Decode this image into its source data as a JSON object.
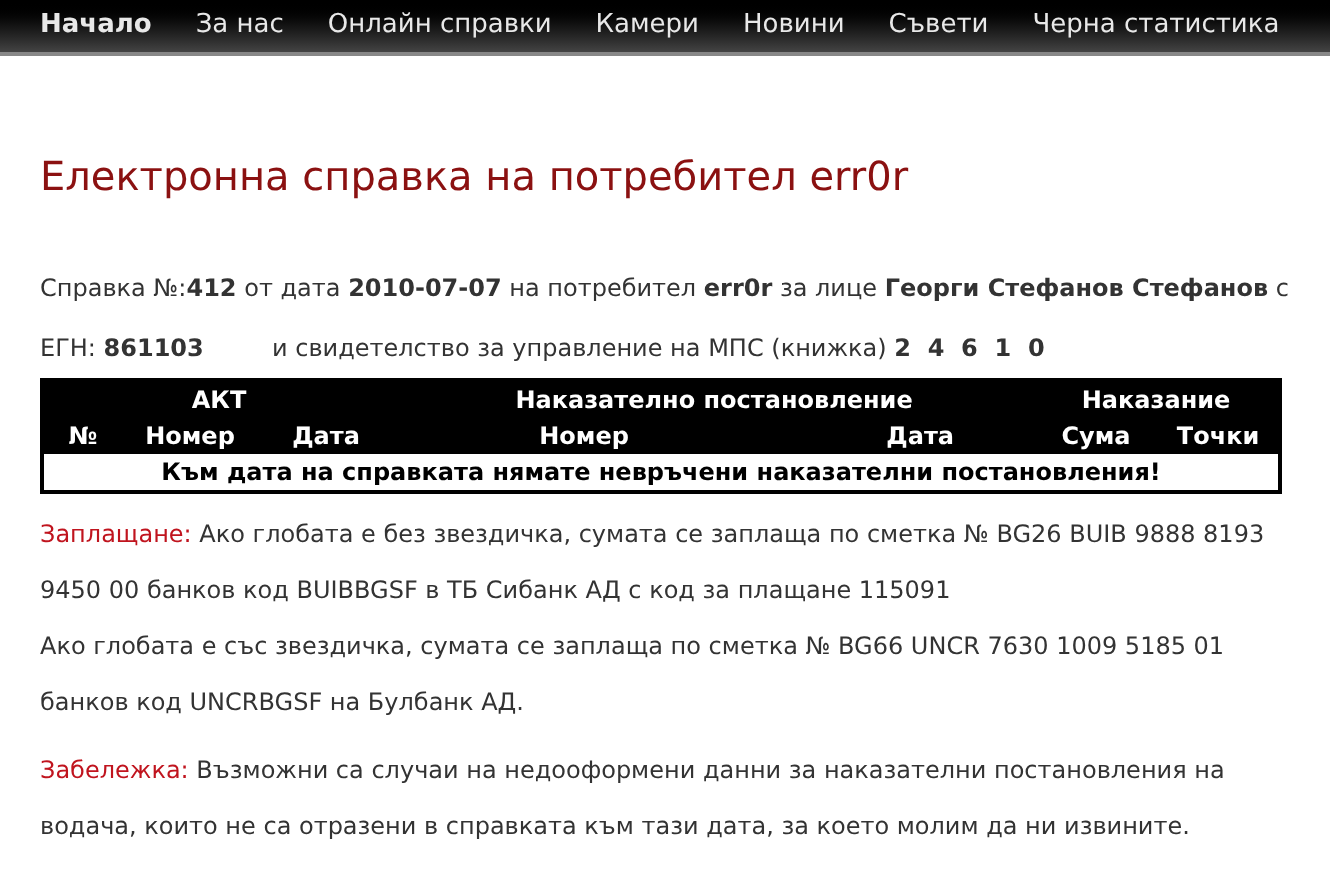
{
  "nav": [
    {
      "label": "Начало",
      "selected": true
    },
    {
      "label": "За нас",
      "selected": false
    },
    {
      "label": "Онлайн справки",
      "selected": false
    },
    {
      "label": "Камери",
      "selected": false
    },
    {
      "label": "Новини",
      "selected": false
    },
    {
      "label": "Съвети",
      "selected": false
    },
    {
      "label": "Черна статистика",
      "selected": false
    }
  ],
  "title": "Електронна справка на потребител err0r",
  "report": {
    "line_1": "Справка №:**412** от дата **2010-07-07** на потребител **err0r** за лице **Георги Стефанов Стефанов** с",
    "egn": "ЕГН: **861103**",
    "license": "и свидетелство за управление на МПС (книжка) **2  4  6  1  0**"
  },
  "table": {
    "groups": [
      "АКТ",
      "Наказателно постановление",
      "Наказание"
    ],
    "columns": [
      "№",
      "Номер",
      "Дата",
      "Номер",
      "Дата",
      "Сума",
      "Точки"
    ],
    "message": "Към дата на справката нямате невръчени наказателни постановления!"
  },
  "notes": [
    {
      "label": "Заплащане:",
      "text": "Ако глобата е без звездичка, сумата се заплаща по сметка № BG26 BUIB 9888 8193 9450 00 банков код BUIBBGSF в ТБ Сибанк АД с код за плащане 115091"
    },
    {
      "text": "Ако глобата е със звездичка, сумата се заплаща по сметка № BG66 UNCR 7630 1009 5185 01 банков код UNCRBGSF на Булбанк АД."
    },
    {
      "label": "Забележка:",
      "text": "Възможни са случаи на недооформени данни за наказателни постановления на водача, които не са отразени в справката към тази дата, за което молим да ни извините."
    }
  ]
}
